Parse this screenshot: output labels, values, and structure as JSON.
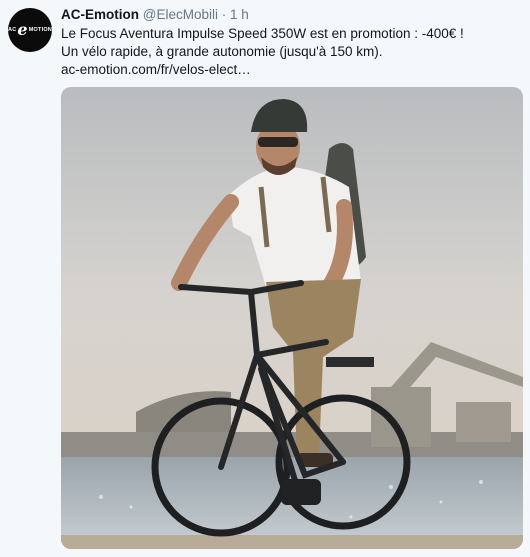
{
  "account": {
    "avatar_text_left": "AC",
    "avatar_text_mid": "e",
    "avatar_text_right": "MOTION",
    "name": "AC-Emotion",
    "handle": "@ElecMobili",
    "separator": "·",
    "time": "1 h"
  },
  "tweet": {
    "line1": "Le Focus Aventura Impulse Speed 350W est en promotion : -400€ !",
    "line2": "Un vélo rapide, à grande autonomie (jusqu'à 150 km).",
    "link": "ac-emotion.com/fr/velos-elect…"
  },
  "media": {
    "icon": "photo-man-riding-e-bike"
  }
}
